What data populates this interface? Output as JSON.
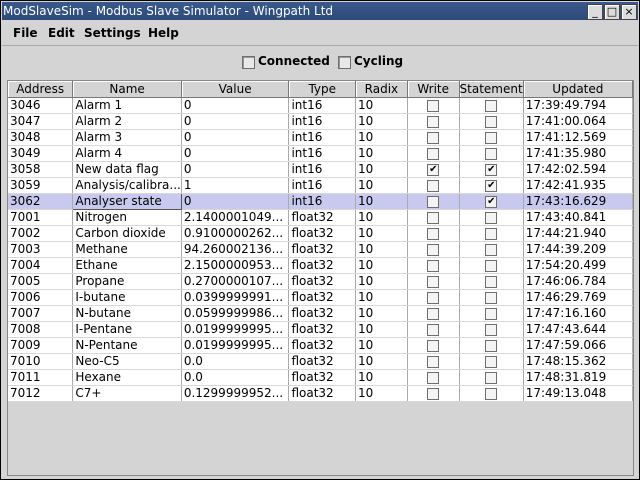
{
  "window": {
    "title": "ModSlaveSim - Modbus Slave Simulator - Wingpath Ltd",
    "controls": [
      "_",
      "□",
      "×"
    ]
  },
  "menu": [
    "File",
    "Edit",
    "Settings",
    "Help"
  ],
  "status": {
    "connected_label": "Connected",
    "connected_checked": false,
    "cycling_label": "Cycling",
    "cycling_checked": false
  },
  "table": {
    "columns": [
      "Address",
      "Name",
      "Value",
      "Type",
      "Radix",
      "Write",
      "Statement",
      "Updated"
    ],
    "selected_row_index": 6,
    "rows": [
      {
        "address": "3046",
        "name": "Alarm 1",
        "value": "0",
        "type": "int16",
        "radix": "10",
        "write": false,
        "statement": false,
        "updated": "17:39:49.794"
      },
      {
        "address": "3047",
        "name": "Alarm 2",
        "value": "0",
        "type": "int16",
        "radix": "10",
        "write": false,
        "statement": false,
        "updated": "17:41:00.064"
      },
      {
        "address": "3048",
        "name": "Alarm 3",
        "value": "0",
        "type": "int16",
        "radix": "10",
        "write": false,
        "statement": false,
        "updated": "17:41:12.569"
      },
      {
        "address": "3049",
        "name": "Alarm 4",
        "value": "0",
        "type": "int16",
        "radix": "10",
        "write": false,
        "statement": false,
        "updated": "17:41:35.980"
      },
      {
        "address": "3058",
        "name": "New  data flag",
        "value": "0",
        "type": "int16",
        "radix": "10",
        "write": true,
        "statement": true,
        "updated": "17:42:02.594"
      },
      {
        "address": "3059",
        "name": "Analysis/calibra...",
        "value": "1",
        "type": "int16",
        "radix": "10",
        "write": false,
        "statement": true,
        "updated": "17:42:41.935"
      },
      {
        "address": "3062",
        "name": "Analyser state",
        "value": "0",
        "type": "int16",
        "radix": "10",
        "write": false,
        "statement": true,
        "updated": "17:43:16.629"
      },
      {
        "address": "7001",
        "name": "Nitrogen",
        "value": "2.1400001049...",
        "type": "float32",
        "radix": "10",
        "write": false,
        "statement": false,
        "updated": "17:43:40.841"
      },
      {
        "address": "7002",
        "name": "Carbon dioxide",
        "value": "0.9100000262...",
        "type": "float32",
        "radix": "10",
        "write": false,
        "statement": false,
        "updated": "17:44:21.940"
      },
      {
        "address": "7003",
        "name": "Methane",
        "value": "94.260002136...",
        "type": "float32",
        "radix": "10",
        "write": false,
        "statement": false,
        "updated": "17:44:39.209"
      },
      {
        "address": "7004",
        "name": "Ethane",
        "value": "2.1500000953...",
        "type": "float32",
        "radix": "10",
        "write": false,
        "statement": false,
        "updated": "17:54:20.499"
      },
      {
        "address": "7005",
        "name": "Propane",
        "value": "0.2700000107...",
        "type": "float32",
        "radix": "10",
        "write": false,
        "statement": false,
        "updated": "17:46:06.784"
      },
      {
        "address": "7006",
        "name": "I-butane",
        "value": "0.0399999991...",
        "type": "float32",
        "radix": "10",
        "write": false,
        "statement": false,
        "updated": "17:46:29.769"
      },
      {
        "address": "7007",
        "name": "N-butane",
        "value": "0.0599999986...",
        "type": "float32",
        "radix": "10",
        "write": false,
        "statement": false,
        "updated": "17:47:16.160"
      },
      {
        "address": "7008",
        "name": "I-Pentane",
        "value": "0.0199999995...",
        "type": "float32",
        "radix": "10",
        "write": false,
        "statement": false,
        "updated": "17:47:43.644"
      },
      {
        "address": "7009",
        "name": "N-Pentane",
        "value": "0.0199999995...",
        "type": "float32",
        "radix": "10",
        "write": false,
        "statement": false,
        "updated": "17:47:59.066"
      },
      {
        "address": "7010",
        "name": "Neo-C5",
        "value": "0.0",
        "type": "float32",
        "radix": "10",
        "write": false,
        "statement": false,
        "updated": "17:48:15.362"
      },
      {
        "address": "7011",
        "name": "Hexane",
        "value": "0.0",
        "type": "float32",
        "radix": "10",
        "write": false,
        "statement": false,
        "updated": "17:48:31.819"
      },
      {
        "address": "7012",
        "name": "C7+",
        "value": "0.1299999952...",
        "type": "float32",
        "radix": "10",
        "write": false,
        "statement": false,
        "updated": "17:49:13.048"
      }
    ]
  }
}
